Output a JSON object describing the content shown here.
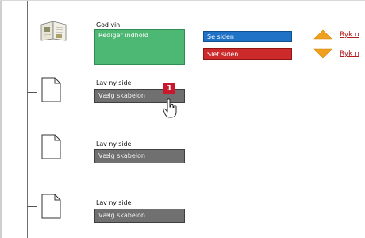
{
  "page_entry": {
    "title": "God vin",
    "edit_label": "Rediger indhold",
    "view_label": "Se siden",
    "delete_label": "Slet siden",
    "move_up_label": "Ryk o",
    "move_down_label": "Ryk n"
  },
  "new_pages": [
    {
      "label": "Lav ny side",
      "template_label": "Vælg skabelon"
    },
    {
      "label": "Lav ny side",
      "template_label": "Vælg skabelon"
    },
    {
      "label": "Lav ny side",
      "template_label": "Vælg skabelon"
    }
  ],
  "step_badge": "1",
  "icons": {
    "page": "book-page-icon",
    "blank_page": "blank-page-icon",
    "move_up": "arrow-up-icon",
    "move_down": "arrow-down-icon",
    "cursor": "hand-pointer-icon"
  },
  "colors": {
    "edit": "#4db874",
    "view": "#1f72c6",
    "delete": "#cc2a2a",
    "template": "#707070",
    "arrow": "#f0a020",
    "badge": "#c9182c",
    "link": "#b01e1e"
  }
}
